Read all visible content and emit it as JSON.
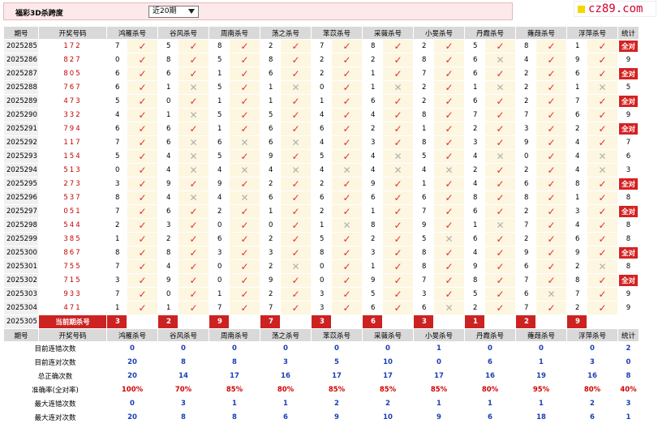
{
  "header": {
    "title": "福彩3D杀跨度",
    "period_select": "近20期"
  },
  "logo": {
    "text": "cz89.com"
  },
  "columns": [
    "期号",
    "开奖号码",
    "鸿雁杀号",
    "谷风杀号",
    "周南杀号",
    "荡之杀号",
    "苯苡杀号",
    "采薇杀号",
    "小旻杀号",
    "丹霞杀号",
    "蕹葭杀号",
    "浮萍杀号",
    "统计"
  ],
  "rows": [
    {
      "period": "2025285",
      "nums": "172",
      "cells": [
        [
          "7",
          1
        ],
        [
          "5",
          1
        ],
        [
          "8",
          1
        ],
        [
          "2",
          1
        ],
        [
          "7",
          1
        ],
        [
          "8",
          1
        ],
        [
          "2",
          1
        ],
        [
          "5",
          1
        ],
        [
          "8",
          1
        ],
        [
          "1",
          1
        ]
      ],
      "total": "全对"
    },
    {
      "period": "2025286",
      "nums": "827",
      "cells": [
        [
          "0",
          1
        ],
        [
          "8",
          1
        ],
        [
          "5",
          1
        ],
        [
          "8",
          1
        ],
        [
          "2",
          1
        ],
        [
          "2",
          1
        ],
        [
          "8",
          1
        ],
        [
          "6",
          0
        ],
        [
          "4",
          1
        ],
        [
          "9",
          1
        ]
      ],
      "total": "9"
    },
    {
      "period": "2025287",
      "nums": "805",
      "cells": [
        [
          "6",
          1
        ],
        [
          "6",
          1
        ],
        [
          "1",
          1
        ],
        [
          "6",
          1
        ],
        [
          "2",
          1
        ],
        [
          "1",
          1
        ],
        [
          "7",
          1
        ],
        [
          "6",
          1
        ],
        [
          "2",
          1
        ],
        [
          "6",
          1
        ]
      ],
      "total": "全对"
    },
    {
      "period": "2025288",
      "nums": "767",
      "cells": [
        [
          "6",
          1
        ],
        [
          "1",
          0
        ],
        [
          "5",
          1
        ],
        [
          "1",
          0
        ],
        [
          "0",
          1
        ],
        [
          "1",
          0
        ],
        [
          "2",
          1
        ],
        [
          "1",
          0
        ],
        [
          "2",
          1
        ],
        [
          "1",
          0
        ]
      ],
      "total": "5"
    },
    {
      "period": "2025289",
      "nums": "473",
      "cells": [
        [
          "5",
          1
        ],
        [
          "0",
          1
        ],
        [
          "1",
          1
        ],
        [
          "1",
          1
        ],
        [
          "1",
          1
        ],
        [
          "6",
          1
        ],
        [
          "2",
          1
        ],
        [
          "6",
          1
        ],
        [
          "2",
          1
        ],
        [
          "7",
          1
        ]
      ],
      "total": "全对"
    },
    {
      "period": "2025290",
      "nums": "332",
      "cells": [
        [
          "4",
          1
        ],
        [
          "1",
          0
        ],
        [
          "5",
          1
        ],
        [
          "5",
          1
        ],
        [
          "4",
          1
        ],
        [
          "4",
          1
        ],
        [
          "8",
          1
        ],
        [
          "7",
          1
        ],
        [
          "7",
          1
        ],
        [
          "6",
          1
        ]
      ],
      "total": "9"
    },
    {
      "period": "2025291",
      "nums": "794",
      "cells": [
        [
          "6",
          1
        ],
        [
          "6",
          1
        ],
        [
          "1",
          1
        ],
        [
          "6",
          1
        ],
        [
          "6",
          1
        ],
        [
          "2",
          1
        ],
        [
          "1",
          1
        ],
        [
          "2",
          1
        ],
        [
          "3",
          1
        ],
        [
          "2",
          1
        ]
      ],
      "total": "全对"
    },
    {
      "period": "2025292",
      "nums": "117",
      "cells": [
        [
          "7",
          1
        ],
        [
          "6",
          0
        ],
        [
          "6",
          0
        ],
        [
          "6",
          0
        ],
        [
          "4",
          1
        ],
        [
          "3",
          1
        ],
        [
          "8",
          1
        ],
        [
          "3",
          1
        ],
        [
          "9",
          1
        ],
        [
          "4",
          1
        ]
      ],
      "total": "7"
    },
    {
      "period": "2025293",
      "nums": "154",
      "cells": [
        [
          "5",
          1
        ],
        [
          "4",
          0
        ],
        [
          "5",
          1
        ],
        [
          "9",
          1
        ],
        [
          "5",
          1
        ],
        [
          "4",
          0
        ],
        [
          "5",
          1
        ],
        [
          "4",
          0
        ],
        [
          "0",
          1
        ],
        [
          "4",
          0
        ]
      ],
      "total": "6"
    },
    {
      "period": "2025294",
      "nums": "513",
      "cells": [
        [
          "0",
          1
        ],
        [
          "4",
          0
        ],
        [
          "4",
          0
        ],
        [
          "4",
          0
        ],
        [
          "4",
          0
        ],
        [
          "4",
          0
        ],
        [
          "4",
          0
        ],
        [
          "2",
          1
        ],
        [
          "2",
          1
        ],
        [
          "4",
          0
        ]
      ],
      "total": "3"
    },
    {
      "period": "2025295",
      "nums": "273",
      "cells": [
        [
          "3",
          1
        ],
        [
          "9",
          1
        ],
        [
          "9",
          1
        ],
        [
          "2",
          1
        ],
        [
          "2",
          1
        ],
        [
          "9",
          1
        ],
        [
          "1",
          1
        ],
        [
          "4",
          1
        ],
        [
          "6",
          1
        ],
        [
          "8",
          1
        ]
      ],
      "total": "全对"
    },
    {
      "period": "2025296",
      "nums": "537",
      "cells": [
        [
          "8",
          1
        ],
        [
          "4",
          0
        ],
        [
          "4",
          0
        ],
        [
          "6",
          1
        ],
        [
          "6",
          1
        ],
        [
          "6",
          1
        ],
        [
          "6",
          1
        ],
        [
          "8",
          1
        ],
        [
          "8",
          1
        ],
        [
          "1",
          1
        ]
      ],
      "total": "8"
    },
    {
      "period": "2025297",
      "nums": "051",
      "cells": [
        [
          "7",
          1
        ],
        [
          "6",
          1
        ],
        [
          "2",
          1
        ],
        [
          "1",
          1
        ],
        [
          "2",
          1
        ],
        [
          "1",
          1
        ],
        [
          "7",
          1
        ],
        [
          "6",
          1
        ],
        [
          "2",
          1
        ],
        [
          "3",
          1
        ]
      ],
      "total": "全对"
    },
    {
      "period": "2025298",
      "nums": "544",
      "cells": [
        [
          "2",
          1
        ],
        [
          "3",
          1
        ],
        [
          "0",
          1
        ],
        [
          "0",
          1
        ],
        [
          "1",
          0
        ],
        [
          "8",
          1
        ],
        [
          "9",
          1
        ],
        [
          "1",
          0
        ],
        [
          "7",
          1
        ],
        [
          "4",
          1
        ]
      ],
      "total": "8"
    },
    {
      "period": "2025299",
      "nums": "385",
      "cells": [
        [
          "1",
          1
        ],
        [
          "2",
          1
        ],
        [
          "6",
          1
        ],
        [
          "2",
          1
        ],
        [
          "5",
          1
        ],
        [
          "2",
          1
        ],
        [
          "5",
          0
        ],
        [
          "6",
          1
        ],
        [
          "2",
          1
        ],
        [
          "6",
          1
        ]
      ],
      "total": "8"
    },
    {
      "period": "2025300",
      "nums": "867",
      "cells": [
        [
          "8",
          1
        ],
        [
          "8",
          1
        ],
        [
          "3",
          1
        ],
        [
          "3",
          1
        ],
        [
          "8",
          1
        ],
        [
          "3",
          1
        ],
        [
          "8",
          1
        ],
        [
          "4",
          1
        ],
        [
          "9",
          1
        ],
        [
          "9",
          1
        ]
      ],
      "total": "全对"
    },
    {
      "period": "2025301",
      "nums": "755",
      "cells": [
        [
          "7",
          1
        ],
        [
          "4",
          1
        ],
        [
          "0",
          1
        ],
        [
          "2",
          0
        ],
        [
          "0",
          1
        ],
        [
          "1",
          1
        ],
        [
          "8",
          1
        ],
        [
          "9",
          1
        ],
        [
          "6",
          1
        ],
        [
          "2",
          0
        ]
      ],
      "total": "8"
    },
    {
      "period": "2025302",
      "nums": "715",
      "cells": [
        [
          "3",
          1
        ],
        [
          "9",
          1
        ],
        [
          "0",
          1
        ],
        [
          "9",
          1
        ],
        [
          "0",
          1
        ],
        [
          "9",
          1
        ],
        [
          "7",
          1
        ],
        [
          "8",
          1
        ],
        [
          "7",
          1
        ],
        [
          "8",
          1
        ]
      ],
      "total": "全对"
    },
    {
      "period": "2025303",
      "nums": "933",
      "cells": [
        [
          "7",
          1
        ],
        [
          "0",
          1
        ],
        [
          "1",
          1
        ],
        [
          "2",
          1
        ],
        [
          "3",
          1
        ],
        [
          "5",
          1
        ],
        [
          "3",
          1
        ],
        [
          "5",
          1
        ],
        [
          "6",
          0
        ],
        [
          "7",
          1
        ]
      ],
      "total": "9"
    },
    {
      "period": "2025304",
      "nums": "471",
      "cells": [
        [
          "1",
          1
        ],
        [
          "1",
          1
        ],
        [
          "7",
          1
        ],
        [
          "7",
          1
        ],
        [
          "3",
          1
        ],
        [
          "6",
          1
        ],
        [
          "6",
          0
        ],
        [
          "2",
          1
        ],
        [
          "7",
          1
        ],
        [
          "2",
          1
        ]
      ],
      "total": "9"
    }
  ],
  "current": {
    "period": "2025305",
    "label": "当前期杀号",
    "values": [
      "3",
      "2",
      "9",
      "7",
      "3",
      "6",
      "3",
      "1",
      "2",
      "9"
    ]
  },
  "stats": [
    {
      "label": "目前连错次数",
      "values": [
        "0",
        "0",
        "0",
        "0",
        "0",
        "0",
        "1",
        "0",
        "0",
        "0",
        "2"
      ]
    },
    {
      "label": "目前连对次数",
      "values": [
        "20",
        "8",
        "8",
        "3",
        "5",
        "10",
        "0",
        "6",
        "1",
        "3",
        "0"
      ]
    },
    {
      "label": "总正确次数",
      "values": [
        "20",
        "14",
        "17",
        "16",
        "17",
        "17",
        "17",
        "16",
        "19",
        "16",
        "8"
      ]
    },
    {
      "label": "准确率(全对率)",
      "values": [
        "100%",
        "70%",
        "85%",
        "80%",
        "85%",
        "85%",
        "85%",
        "80%",
        "95%",
        "80%",
        "40%"
      ],
      "red": true
    },
    {
      "label": "最大连错次数",
      "values": [
        "0",
        "3",
        "1",
        "1",
        "2",
        "2",
        "1",
        "1",
        "1",
        "2",
        "3"
      ]
    },
    {
      "label": "最大连对次数",
      "values": [
        "20",
        "8",
        "8",
        "6",
        "9",
        "10",
        "9",
        "6",
        "18",
        "6",
        "1"
      ]
    }
  ],
  "colors": {
    "accent": "#cc2222",
    "ok": "#e03030",
    "bad": "#b0b0b0",
    "stat": "#1a3fb4"
  }
}
